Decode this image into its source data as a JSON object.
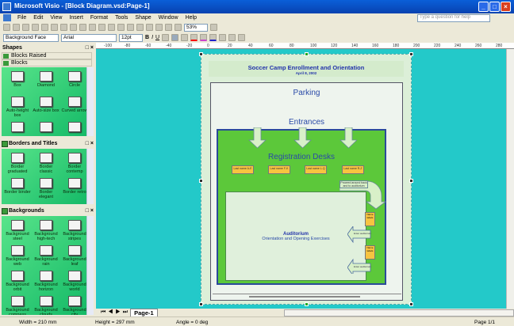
{
  "window": {
    "title": "Microsoft Visio - [Block Diagram.vsd:Page-1]",
    "help_placeholder": "Type a question for help"
  },
  "menu": [
    "File",
    "Edit",
    "View",
    "Insert",
    "Format",
    "Tools",
    "Shape",
    "Window",
    "Help"
  ],
  "toolbar": {
    "zoom": "53%",
    "style": "Background Face",
    "font": "Arial",
    "size": "12pt",
    "bold": "B",
    "italic": "I",
    "underline": "U"
  },
  "ruler": [
    "-100",
    "-80",
    "-60",
    "-40",
    "-20",
    "0",
    "20",
    "40",
    "60",
    "80",
    "100",
    "120",
    "140",
    "160",
    "180",
    "200",
    "220",
    "240",
    "260",
    "280"
  ],
  "shapes_panel": {
    "title": "Shapes",
    "stencils": [
      {
        "title": "Blocks Raised"
      },
      {
        "title": "Blocks",
        "items": [
          "Box",
          "Diamond",
          "Circle",
          "Auto-height box",
          "Auto-size box",
          "Curved arrow",
          "",
          "",
          ""
        ]
      }
    ]
  },
  "borders_panel": {
    "title": "Borders and Titles",
    "items": [
      "Border graduated",
      "Border classic",
      "Border contemp",
      "Border binder",
      "Border elegant",
      "Border retro"
    ]
  },
  "backgrounds_panel": {
    "title": "Backgrounds",
    "items": [
      "Background steel",
      "Background high-tech",
      "Background stripes",
      "Background web",
      "Background rain",
      "Background leaf",
      "Background orbit",
      "Background horizon",
      "Background world",
      "Background compass",
      "Background clouds",
      "Background city"
    ]
  },
  "diagram": {
    "title": "Soccer Camp Enrollment and Orientation",
    "date": "April 8, 2002",
    "parking": "Parking",
    "entrances": "Entrances",
    "registration": "Registration Desks",
    "desks": [
      "Last name A-E",
      "Last name F-K",
      "Last name L-Q",
      "Last name R-Z"
    ],
    "note": "Proceed around back and to auditorium",
    "auditorium": "Auditorium",
    "auditorium_sub": "Orientation and Opening Exercises",
    "name_labels": [
      "Name labels",
      "Name labels"
    ],
    "enter": [
      "Enter auditorium",
      "Enter auditorium"
    ],
    "colors": {
      "green": "#5cc83a",
      "canvas": "#23c9c9",
      "title_blue": "#2233aa"
    }
  },
  "tabs": {
    "page": "Page-1"
  },
  "status": {
    "width": "Width = 210 mm",
    "height": "Height = 297 mm",
    "angle": "Angle = 0 deg",
    "page": "Page 1/1"
  }
}
